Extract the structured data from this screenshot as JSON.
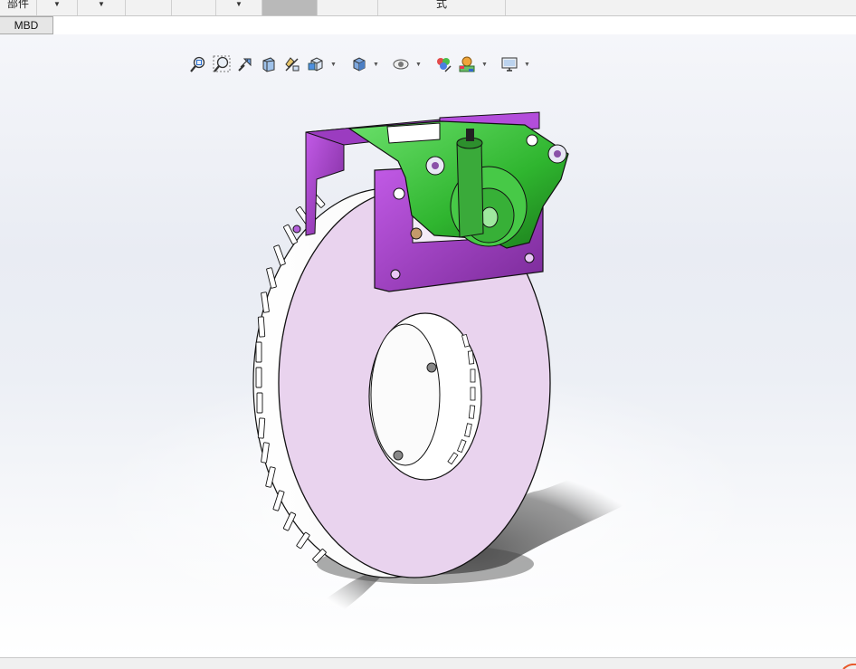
{
  "tabs": {
    "items": [
      {
        "label": "部件"
      },
      {
        "label": ""
      },
      {
        "label": ""
      },
      {
        "label": ""
      },
      {
        "label": ""
      },
      {
        "label": ""
      },
      {
        "label": ""
      },
      {
        "label": ""
      },
      {
        "label": "式"
      }
    ]
  },
  "secondary_tab": {
    "label": "MBD"
  },
  "view_toolbar": {
    "icons": [
      "zoom-to-fit-icon",
      "zoom-to-area-icon",
      "previous-view-icon",
      "section-view-icon",
      "dynamic-annotation-icon",
      "view-orientation-icon",
      "display-style-icon",
      "hide-show-items-icon",
      "edit-appearance-icon",
      "apply-scene-icon",
      "view-settings-icon"
    ]
  },
  "colors": {
    "bracket": "#a23ad0",
    "caliper": "#3fbf3f",
    "rotor": "#e9d3ee",
    "outline": "#1a1a1a",
    "accent_corner": "#e8582a"
  }
}
